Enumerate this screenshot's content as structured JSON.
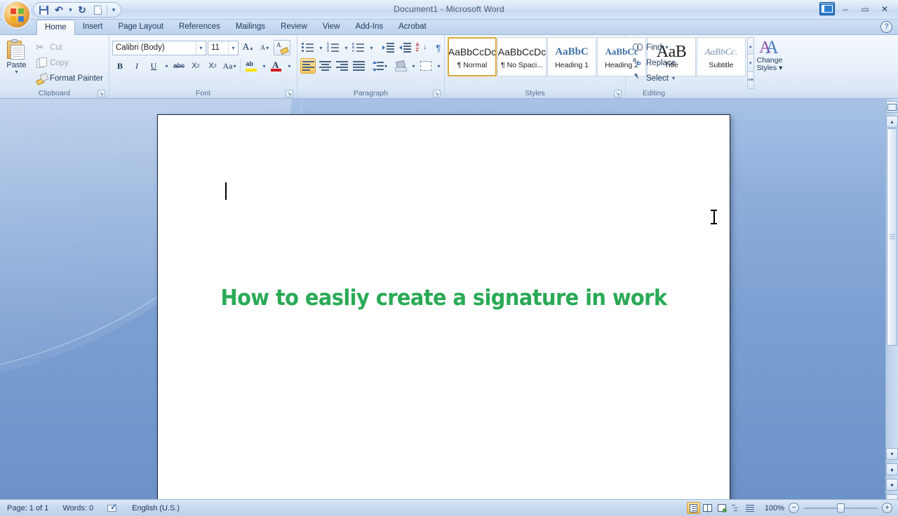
{
  "window": {
    "title": "Document1 - Microsoft Word",
    "minimize_label": "–",
    "restore_label": "▭",
    "close_label": "✕",
    "restore_down_name": "restore-window",
    "help_label": "?"
  },
  "quick_access": {
    "items": [
      {
        "name": "save-button",
        "label": "Save"
      },
      {
        "name": "undo-button",
        "label": "Undo"
      },
      {
        "name": "undo-dropdown",
        "label": "▾"
      },
      {
        "name": "redo-button",
        "label": "↻"
      },
      {
        "name": "new-document-button",
        "label": "New"
      },
      {
        "name": "customize-qat-button",
        "label": "▾"
      }
    ]
  },
  "ribbon": {
    "tabs": [
      {
        "label": "Home",
        "active": true
      },
      {
        "label": "Insert",
        "active": false
      },
      {
        "label": "Page Layout",
        "active": false
      },
      {
        "label": "References",
        "active": false
      },
      {
        "label": "Mailings",
        "active": false
      },
      {
        "label": "Review",
        "active": false
      },
      {
        "label": "View",
        "active": false
      },
      {
        "label": "Add-Ins",
        "active": false
      },
      {
        "label": "Acrobat",
        "active": false
      }
    ],
    "clipboard": {
      "group_label": "Clipboard",
      "paste_label": "Paste",
      "paste_caret": "▾",
      "cut_label": "Cut",
      "copy_label": "Copy",
      "format_painter_label": "Format Painter",
      "launcher_label": "↘"
    },
    "font": {
      "group_label": "Font",
      "font_name": "Calibri (Body)",
      "font_size": "11",
      "grow_font_label": "A",
      "shrink_font_label": "A",
      "clear_formatting_label": "Clear Formatting",
      "bold_label": "B",
      "italic_label": "I",
      "underline_label": "U",
      "strikethrough_label": "abc",
      "subscript_label": "X",
      "superscript_label": "X",
      "change_case_label": "Aa",
      "highlight_label": "ab",
      "font_color_label": "A",
      "caret": "▾",
      "launcher_label": "↘"
    },
    "paragraph": {
      "group_label": "Paragraph",
      "bullets_label": "Bullets",
      "numbering_label": "Numbering",
      "multilevel_label": "Multilevel List",
      "decrease_indent_label": "Decrease Indent",
      "increase_indent_label": "Increase Indent",
      "sort_label": "Sort",
      "show_marks_label": "¶",
      "align_left_label": "Align Left",
      "align_center_label": "Center",
      "align_right_label": "Align Right",
      "justify_label": "Justify",
      "line_spacing_label": "Line Spacing",
      "shading_label": "Shading",
      "borders_label": "Borders",
      "caret": "▾",
      "launcher_label": "↘"
    },
    "styles": {
      "group_label": "Styles",
      "gallery": [
        {
          "sample": "AaBbCcDc",
          "name": "¶ Normal",
          "selected": true,
          "kind": "normal"
        },
        {
          "sample": "AaBbCcDc",
          "name": "¶ No Spaci...",
          "selected": false,
          "kind": "normal"
        },
        {
          "sample": "AaBbC",
          "name": "Heading 1",
          "selected": false,
          "kind": "heading"
        },
        {
          "sample": "AaBbCc",
          "name": "Heading 2",
          "selected": false,
          "kind": "heading"
        },
        {
          "sample": "AaB",
          "name": "Title",
          "selected": false,
          "kind": "title"
        },
        {
          "sample": "AaBbCc.",
          "name": "Subtitle",
          "selected": false,
          "kind": "subtitle"
        }
      ],
      "scroll_up_label": "▴",
      "scroll_down_label": "▾",
      "more_label": "▾",
      "change_styles_line1": "Change",
      "change_styles_line2": "Styles ▾",
      "launcher_label": "↘"
    },
    "editing": {
      "group_label": "Editing",
      "find_label": "Find",
      "find_caret": "▾",
      "replace_label": "Replace",
      "select_label": "Select",
      "select_caret": "▾"
    }
  },
  "document": {
    "heading_text": "How to easliy create a signature in work",
    "heading_color": "#2aaa56",
    "caret_visible": true
  },
  "scrollbar": {
    "ruler_toggle_label": "View Ruler",
    "up_label": "▴",
    "down_label": "▾",
    "previous_page_label": "▴",
    "select_object_label": "●",
    "next_page_label": "▾"
  },
  "status_bar": {
    "page_text": "Page: 1 of 1",
    "words_text": "Words: 0",
    "language_text": "English (U.S.)",
    "proofing_label": "Proofing errors",
    "zoom_level": "100%",
    "zoom_out_label": "−",
    "zoom_in_label": "+",
    "views": [
      {
        "name": "print-layout",
        "label": "Print Layout",
        "active": true
      },
      {
        "name": "full-screen-reading",
        "label": "Full Screen Reading",
        "active": false
      },
      {
        "name": "web-layout",
        "label": "Web Layout",
        "active": false
      },
      {
        "name": "outline",
        "label": "Outline",
        "active": false
      },
      {
        "name": "draft",
        "label": "Draft",
        "active": false
      }
    ]
  }
}
